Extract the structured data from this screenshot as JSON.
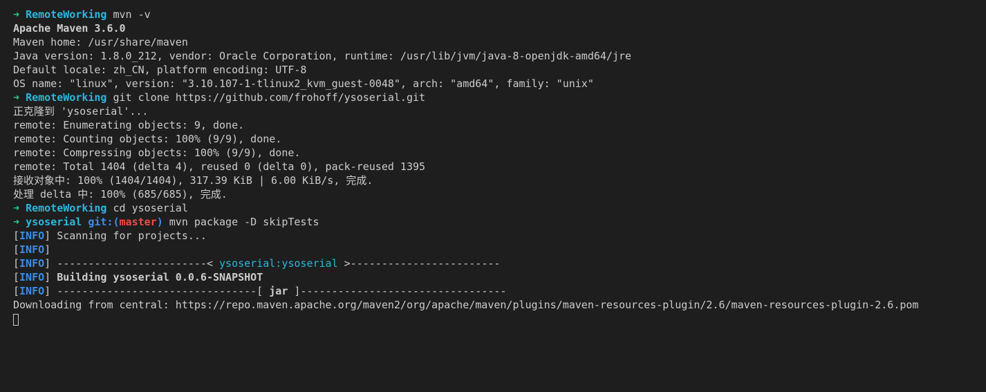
{
  "colors": {
    "background": "#1e1e1e",
    "foreground": "#cccccc",
    "prompt_arrow": "#23d18b",
    "prompt_dir": "#29b8db",
    "git_label": "#3b8eea",
    "git_branch": "#f14c4c",
    "info_tag": "#3b8eea"
  },
  "prompt": {
    "arrow": "➜",
    "dir_home": "RemoteWorking",
    "dir_repo": "ysoserial",
    "git_open": "git:(",
    "git_branch": "master",
    "git_close": ")"
  },
  "commands": {
    "mvn_version": "mvn -v",
    "git_clone": "git clone https://github.com/frohoff/ysoserial.git",
    "cd": "cd ysoserial",
    "mvn_package": "mvn package -D skipTests"
  },
  "mvn_version_output": {
    "title": "Apache Maven 3.6.0",
    "home": "Maven home: /usr/share/maven",
    "java": "Java version: 1.8.0_212, vendor: Oracle Corporation, runtime: /usr/lib/jvm/java-8-openjdk-amd64/jre",
    "locale": "Default locale: zh_CN, platform encoding: UTF-8",
    "os": "OS name: \"linux\", version: \"3.10.107-1-tlinux2_kvm_guest-0048\", arch: \"amd64\", family: \"unix\""
  },
  "git_clone_output": [
    "正克隆到 'ysoserial'...",
    "remote: Enumerating objects: 9, done.",
    "remote: Counting objects: 100% (9/9), done.",
    "remote: Compressing objects: 100% (9/9), done.",
    "remote: Total 1404 (delta 4), reused 0 (delta 0), pack-reused 1395",
    "接收对象中: 100% (1404/1404), 317.39 KiB | 6.00 KiB/s, 完成.",
    "处理 delta 中: 100% (685/685), 完成."
  ],
  "maven_build": {
    "bracket_open": "[",
    "info_tag": "INFO",
    "bracket_close": "]",
    "scanning": " Scanning for projects...",
    "project_sep_left": " ------------------------< ",
    "project_id": "ysoserial:ysoserial",
    "project_sep_right": " >------------------------",
    "building": " Building ysoserial 0.0.6-SNAPSHOT",
    "packaging_sep_left": " --------------------------------[ ",
    "packaging": "jar",
    "packaging_sep_right": " ]---------------------------------",
    "downloading": "Downloading from central: https://repo.maven.apache.org/maven2/org/apache/maven/plugins/maven-resources-plugin/2.6/maven-resources-plugin-2.6.pom"
  }
}
